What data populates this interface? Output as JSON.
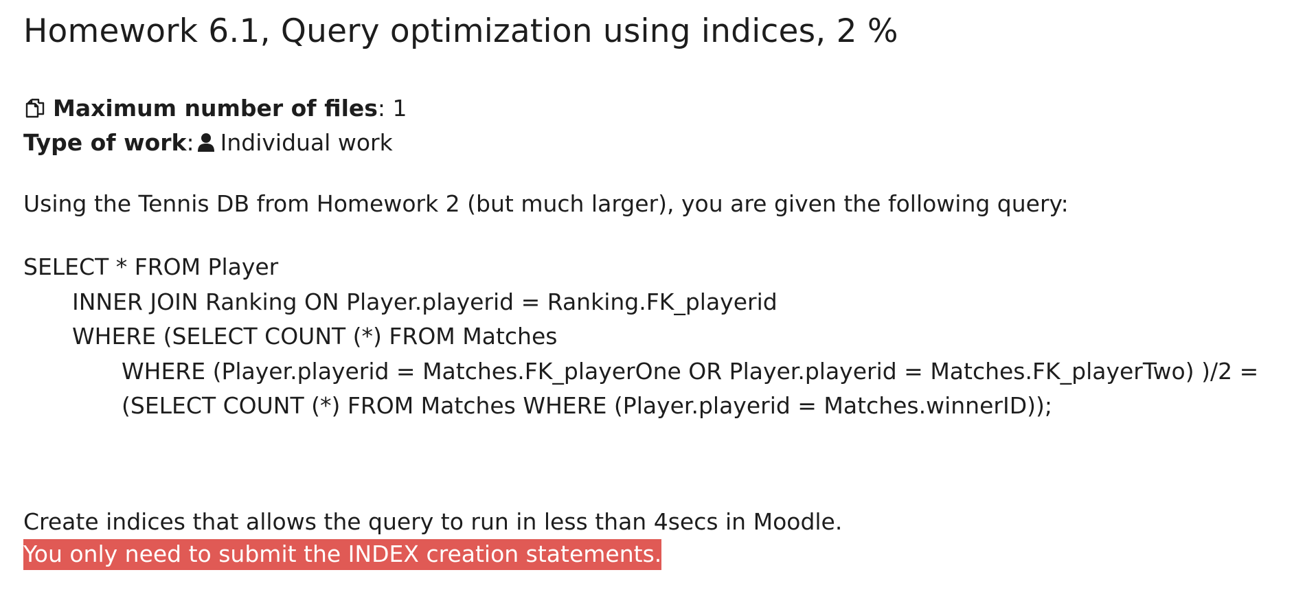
{
  "title": "Homework 6.1, Query optimization using indices, 2 %",
  "meta": {
    "files_label": "Maximum number of files",
    "files_value": ": 1",
    "type_label": "Type of work",
    "type_sep": ":",
    "type_value": "Individual work",
    "files_icon": "copy-files-icon",
    "type_icon": "user-icon"
  },
  "intro": "Using the Tennis DB from Homework 2 (but much larger), you are given the following query:",
  "query": {
    "line1": "SELECT * FROM Player",
    "line2": "INNER JOIN Ranking ON Player.playerid = Ranking.FK_playerid",
    "line3": "WHERE (SELECT COUNT (*) FROM Matches",
    "line4": "WHERE (Player.playerid = Matches.FK_playerOne OR Player.playerid = Matches.FK_playerTwo) )/2 =",
    "line5": "(SELECT COUNT (*) FROM Matches WHERE (Player.playerid = Matches.winnerID));"
  },
  "task": "Create indices that allows the query to run in less than 4secs in Moodle.",
  "highlight_note": "You only need to submit the INDEX creation statements.",
  "colors": {
    "highlight_bg": "#e05a55",
    "highlight_text": "#ffffff",
    "text": "#1d1d1d"
  }
}
